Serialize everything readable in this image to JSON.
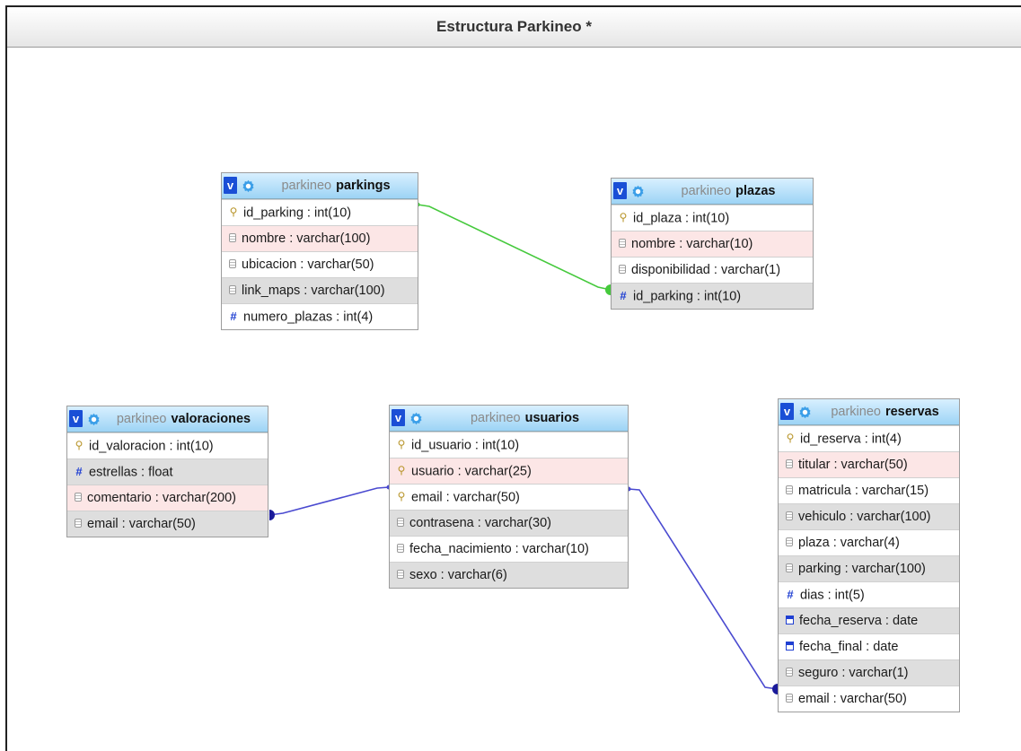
{
  "title": "Estructura Parkineo *",
  "colors": {
    "link_green": "#45c93c",
    "link_blue": "#4a4ad0",
    "header_top": "#d8f0ff",
    "header_bottom": "#9dd4f5"
  },
  "tables": {
    "parkings": {
      "v_label": "v",
      "db": "parkineo",
      "name": "parkings",
      "columns": [
        {
          "text": "id_parking : int(10)",
          "icon": "key-icon"
        },
        {
          "text": "nombre : varchar(100)",
          "icon": "text-icon"
        },
        {
          "text": "ubicacion : varchar(50)",
          "icon": "text-icon"
        },
        {
          "text": "link_maps : varchar(100)",
          "icon": "text-icon"
        },
        {
          "text": "numero_plazas : int(4)",
          "icon": "number-icon"
        }
      ]
    },
    "plazas": {
      "v_label": "v",
      "db": "parkineo",
      "name": "plazas",
      "columns": [
        {
          "text": "id_plaza : int(10)",
          "icon": "key-icon"
        },
        {
          "text": "nombre : varchar(10)",
          "icon": "text-icon"
        },
        {
          "text": "disponibilidad : varchar(1)",
          "icon": "text-icon"
        },
        {
          "text": "id_parking : int(10)",
          "icon": "number-icon"
        }
      ]
    },
    "valoraciones": {
      "v_label": "v",
      "db": "parkineo",
      "name": "valoraciones",
      "columns": [
        {
          "text": "id_valoracion : int(10)",
          "icon": "key-icon"
        },
        {
          "text": "estrellas : float",
          "icon": "number-icon"
        },
        {
          "text": "comentario : varchar(200)",
          "icon": "text-icon"
        },
        {
          "text": "email : varchar(50)",
          "icon": "text-icon"
        }
      ]
    },
    "usuarios": {
      "v_label": "v",
      "db": "parkineo",
      "name": "usuarios",
      "columns": [
        {
          "text": "id_usuario : int(10)",
          "icon": "key-icon"
        },
        {
          "text": "usuario : varchar(25)",
          "icon": "key-icon"
        },
        {
          "text": "email : varchar(50)",
          "icon": "key-icon"
        },
        {
          "text": "contrasena : varchar(30)",
          "icon": "text-icon"
        },
        {
          "text": "fecha_nacimiento : varchar(10)",
          "icon": "text-icon"
        },
        {
          "text": "sexo : varchar(6)",
          "icon": "text-icon"
        }
      ]
    },
    "reservas": {
      "v_label": "v",
      "db": "parkineo",
      "name": "reservas",
      "columns": [
        {
          "text": "id_reserva : int(4)",
          "icon": "key-icon"
        },
        {
          "text": "titular : varchar(50)",
          "icon": "text-icon"
        },
        {
          "text": "matricula : varchar(15)",
          "icon": "text-icon"
        },
        {
          "text": "vehiculo : varchar(100)",
          "icon": "text-icon"
        },
        {
          "text": "plaza : varchar(4)",
          "icon": "text-icon"
        },
        {
          "text": "parking : varchar(100)",
          "icon": "text-icon"
        },
        {
          "text": "dias : int(5)",
          "icon": "number-icon"
        },
        {
          "text": "fecha_reserva : date",
          "icon": "date-icon"
        },
        {
          "text": "fecha_final : date",
          "icon": "date-icon"
        },
        {
          "text": "seguro : varchar(1)",
          "icon": "text-icon"
        },
        {
          "text": "email : varchar(50)",
          "icon": "text-icon"
        }
      ]
    }
  },
  "relations": [
    {
      "from": "parkings.id_parking",
      "to": "plazas.id_parking",
      "color": "#45c93c"
    },
    {
      "from": "usuarios.email",
      "to": "valoraciones.email",
      "color": "#4a4ad0"
    },
    {
      "from": "usuarios.email",
      "to": "reservas.email",
      "color": "#4a4ad0"
    }
  ]
}
